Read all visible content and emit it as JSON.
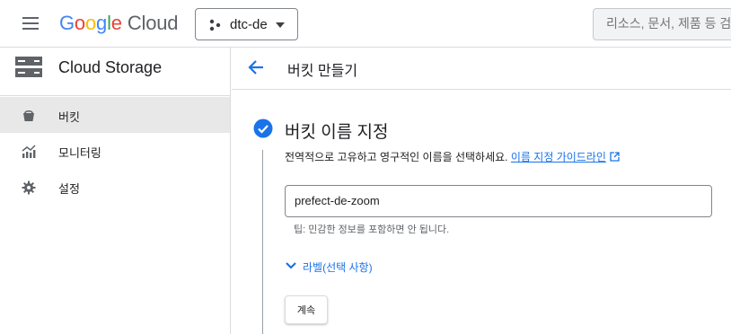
{
  "header": {
    "logo_google": [
      "G",
      "o",
      "o",
      "g",
      "l",
      "e"
    ],
    "logo_cloud": "Cloud",
    "project": "dtc-de",
    "search_placeholder": "리소스, 문서, 제품 등 검"
  },
  "sidebar": {
    "title": "Cloud Storage",
    "items": [
      {
        "label": "버킷",
        "icon": "bucket-icon",
        "active": true
      },
      {
        "label": "모니터링",
        "icon": "chart-icon",
        "active": false
      },
      {
        "label": "설정",
        "icon": "gear-icon",
        "active": false
      }
    ]
  },
  "page": {
    "title": "버킷 만들기",
    "step": {
      "title": "버킷 이름 지정",
      "description": "전역적으로 고유하고 영구적인 이름을 선택하세요.",
      "guide_link": "이름 지정 가이드라인",
      "name_value": "prefect-de-zoom",
      "hint": "팁: 민감한 정보를 포함하면 안 됩니다.",
      "labels_toggle": "라벨(선택 사항)",
      "continue_label": "계속"
    }
  },
  "colors": {
    "accent": "#1a73e8",
    "active_nav_bg": "#e8e8e8",
    "border": "#dadce0"
  }
}
